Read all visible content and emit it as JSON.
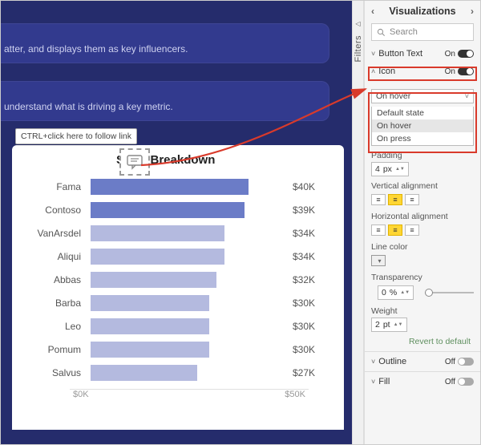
{
  "canvas": {
    "card1_text": "atter, and displays them as key influencers.",
    "card2_text": "understand what is driving a key metric.",
    "tooltip": "CTRL+click here to follow link"
  },
  "chart_data": {
    "type": "bar",
    "title": "Store Breakdown",
    "categories": [
      "Fama",
      "Contoso",
      "VanArsdel",
      "Aliqui",
      "Abbas",
      "Barba",
      "Leo",
      "Pomum",
      "Salvus"
    ],
    "values": [
      40,
      39,
      34,
      34,
      32,
      30,
      30,
      30,
      27
    ],
    "value_labels": [
      "$40K",
      "$39K",
      "$34K",
      "$34K",
      "$32K",
      "$30K",
      "$30K",
      "$30K",
      "$27K"
    ],
    "bar_colors": [
      "#6b7cc7",
      "#6b7cc7",
      "#b4badf",
      "#b4badf",
      "#b4badf",
      "#b4badf",
      "#b4badf",
      "#b4badf",
      "#b4badf"
    ],
    "xticks": [
      "$0K",
      "$50K"
    ],
    "xlabel": "",
    "ylabel": "",
    "xlim": [
      0,
      50
    ]
  },
  "filters_tab": {
    "label": "Filters"
  },
  "vis": {
    "title": "Visualizations",
    "search_placeholder": "Search",
    "button_text": {
      "label": "Button Text",
      "state": "On"
    },
    "icon_section": {
      "label": "Icon",
      "state": "On"
    },
    "state_dropdown": {
      "selected": "On hover",
      "options": [
        "Default state",
        "On hover",
        "On press"
      ]
    },
    "padding": {
      "label": "Padding",
      "value": "4",
      "unit": "px"
    },
    "valign": {
      "label": "Vertical alignment",
      "active_index": 1
    },
    "halign": {
      "label": "Horizontal alignment",
      "active_index": 1
    },
    "line_color": {
      "label": "Line color",
      "swatch": "#efefef"
    },
    "transparency": {
      "label": "Transparency",
      "value": "0",
      "unit": "%"
    },
    "weight": {
      "label": "Weight",
      "value": "2",
      "unit": "pt"
    },
    "revert": "Revert to default",
    "outline": {
      "label": "Outline",
      "state": "Off"
    },
    "fill": {
      "label": "Fill",
      "state": "Off"
    }
  }
}
